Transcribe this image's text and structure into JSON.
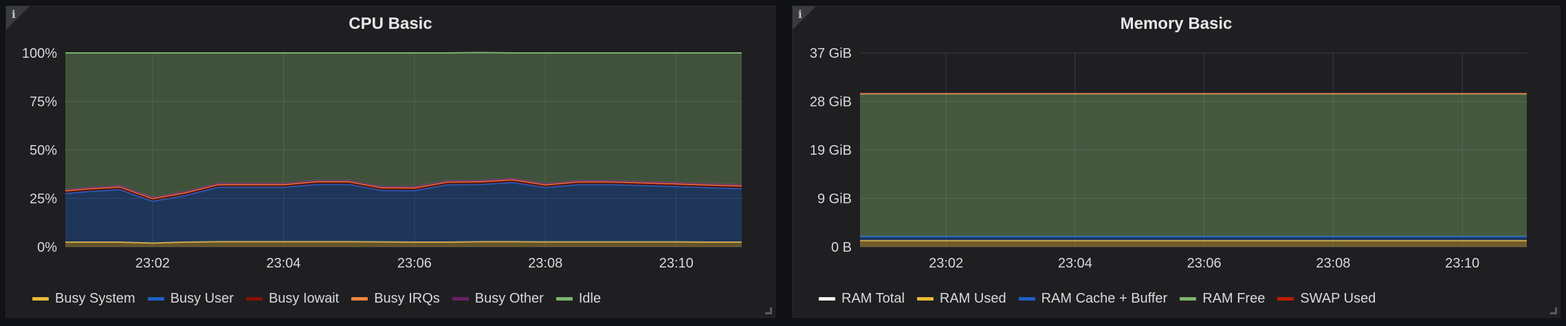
{
  "cpu_panel": {
    "title": "CPU Basic",
    "info_icon": "info-icon",
    "chart_data": {
      "type": "area",
      "stacked": true,
      "title": "CPU Basic",
      "x": [
        "23:00:40",
        "23:01",
        "23:01:30",
        "23:02",
        "23:02:30",
        "23:03",
        "23:03:30",
        "23:04",
        "23:04:30",
        "23:05",
        "23:05:30",
        "23:06",
        "23:06:30",
        "23:07",
        "23:07:30",
        "23:08",
        "23:08:30",
        "23:09",
        "23:09:30",
        "23:10",
        "23:10:30",
        "23:11"
      ],
      "xticks": [
        "23:02",
        "23:04",
        "23:06",
        "23:08",
        "23:10"
      ],
      "yticks": [
        "0%",
        "25%",
        "50%",
        "75%",
        "100%"
      ],
      "ylim": [
        0,
        100
      ],
      "series": [
        {
          "name": "Busy System",
          "color": "#eab839",
          "values": [
            2.5,
            2.5,
            2.5,
            2.0,
            2.5,
            2.7,
            2.7,
            2.7,
            2.7,
            2.7,
            2.6,
            2.5,
            2.5,
            2.7,
            2.7,
            2.6,
            2.6,
            2.6,
            2.6,
            2.6,
            2.5,
            2.5
          ]
        },
        {
          "name": "Busy User",
          "color": "#1f60c4",
          "values": [
            25,
            26,
            27,
            21.5,
            24,
            28,
            28,
            28,
            29.5,
            29.5,
            26.5,
            26.5,
            29.5,
            29.5,
            30.5,
            28,
            29.5,
            29.5,
            29,
            28.5,
            28,
            27.5
          ]
        },
        {
          "name": "Busy Iowait",
          "color": "#890f02",
          "values": [
            1.2,
            1.2,
            1.2,
            1.2,
            1.2,
            1.2,
            1.2,
            1.2,
            1.2,
            1.2,
            1.2,
            1.2,
            1.2,
            1.2,
            1.2,
            1.2,
            1.2,
            1.2,
            1.2,
            1.2,
            1.2,
            1.2
          ]
        },
        {
          "name": "Busy IRQs",
          "color": "#ef843c",
          "values": [
            0.3,
            0.3,
            0.3,
            0.3,
            0.3,
            0.3,
            0.3,
            0.3,
            0.3,
            0.3,
            0.3,
            0.3,
            0.3,
            0.3,
            0.3,
            0.3,
            0.3,
            0.3,
            0.3,
            0.3,
            0.3,
            0.3
          ]
        },
        {
          "name": "Busy Other",
          "color": "#6d1f62",
          "values": [
            0.5,
            0.5,
            0.5,
            0.5,
            0.5,
            0.5,
            0.5,
            0.5,
            0.5,
            0.5,
            0.5,
            0.5,
            0.5,
            0.5,
            0.5,
            0.5,
            0.5,
            0.5,
            0.5,
            0.5,
            0.5,
            0.5
          ]
        },
        {
          "name": "Idle",
          "color": "#7eb26d",
          "values": [
            70.5,
            69.5,
            68.5,
            74.5,
            71.5,
            67.3,
            67.3,
            67.3,
            65.8,
            65.8,
            68.9,
            69,
            66,
            66,
            64.8,
            67.4,
            65.9,
            65.9,
            66.4,
            66.9,
            67.5,
            68
          ]
        }
      ]
    },
    "legend": [
      {
        "label": "Busy System",
        "color": "#eab839"
      },
      {
        "label": "Busy User",
        "color": "#1f60c4"
      },
      {
        "label": "Busy Iowait",
        "color": "#890f02"
      },
      {
        "label": "Busy IRQs",
        "color": "#ef843c"
      },
      {
        "label": "Busy Other",
        "color": "#6d1f62"
      },
      {
        "label": "Idle",
        "color": "#7eb26d"
      }
    ]
  },
  "memory_panel": {
    "title": "Memory Basic",
    "info_icon": "info-icon",
    "chart_data": {
      "type": "area",
      "title": "Memory Basic",
      "x": [
        "23:00:40",
        "23:11"
      ],
      "xticks": [
        "23:02",
        "23:04",
        "23:06",
        "23:08",
        "23:10"
      ],
      "yticks": [
        "0 B",
        "9 GiB",
        "19 GiB",
        "28 GiB",
        "37 GiB"
      ],
      "ylim": [
        0,
        37.25
      ],
      "series": [
        {
          "name": "RAM Total",
          "color": "#f2f2f2",
          "values": [
            29.4,
            29.4
          ]
        },
        {
          "name": "RAM Used",
          "color": "#eab839",
          "values": [
            1.2,
            1.2
          ]
        },
        {
          "name": "RAM Cache + Buffer",
          "color": "#1f60c4",
          "values": [
            0.8,
            0.8
          ]
        },
        {
          "name": "RAM Free",
          "color": "#7eb26d",
          "values": [
            27.4,
            27.4
          ]
        },
        {
          "name": "SWAP Used",
          "color": "#bf1b00",
          "values": [
            0.05,
            0.05
          ]
        }
      ]
    },
    "legend": [
      {
        "label": "RAM Total",
        "color": "#f2f2f2"
      },
      {
        "label": "RAM Used",
        "color": "#eab839"
      },
      {
        "label": "RAM Cache + Buffer",
        "color": "#1f60c4"
      },
      {
        "label": "RAM Free",
        "color": "#7eb26d"
      },
      {
        "label": "SWAP Used",
        "color": "#bf1b00"
      }
    ]
  }
}
